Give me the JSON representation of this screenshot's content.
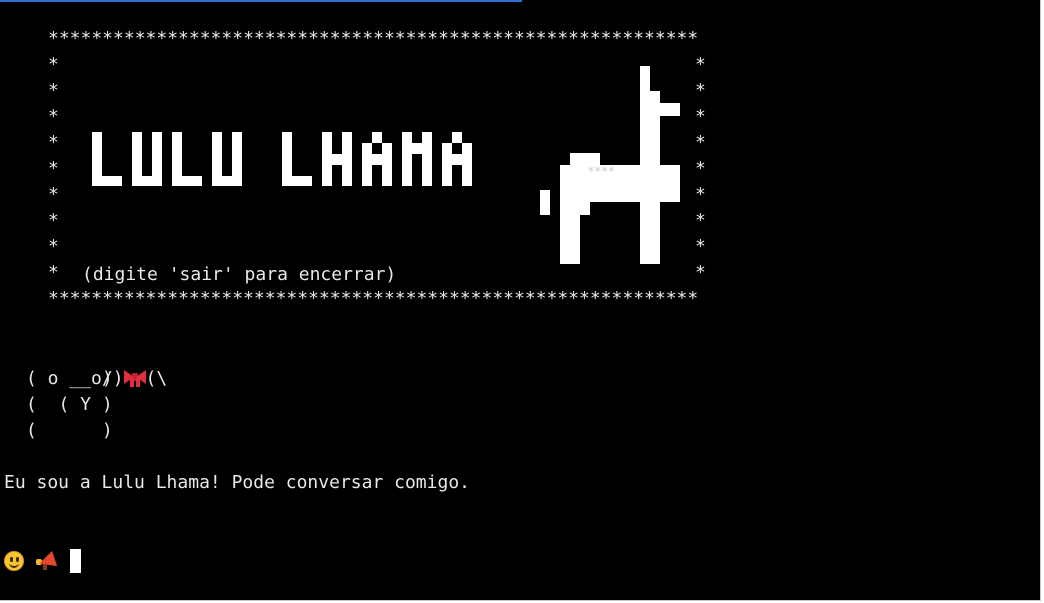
{
  "banner": {
    "border": "************************************************************",
    "side_char": "*",
    "logo_text": "LULU LHAMA",
    "hint": "(digite 'sair' para encerrar)",
    "blanket_pattern": "****"
  },
  "ascii_llama": {
    "row1_left": " /)",
    "row1_right": "(\\",
    "row2": "( o __o)",
    "row3": "(  ( Y )",
    "row4": "(      )"
  },
  "message": "Eu sou a Lulu Lhama! Pode conversar comigo.",
  "prompt": {
    "icons": [
      "smiley-emoji",
      "megaphone-emoji",
      "block-cursor"
    ]
  },
  "colors": {
    "background": "#000000",
    "text": "#e8e8e8",
    "bow": "#e0303f",
    "focus_bar": "#2f6fd0"
  }
}
